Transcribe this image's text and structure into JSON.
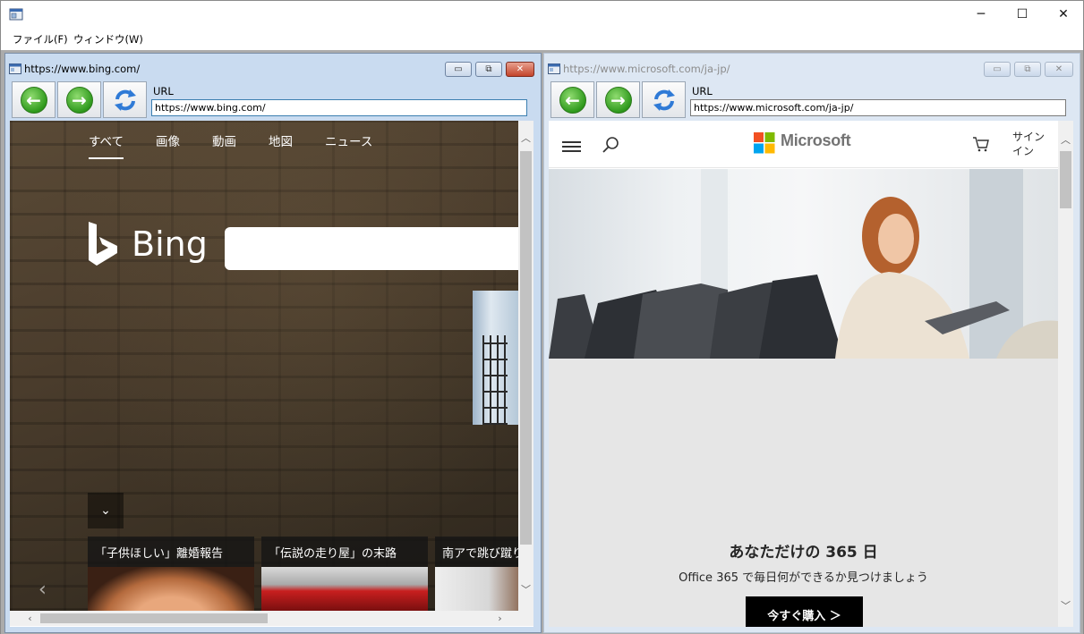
{
  "app": {
    "menu": [
      "ファイル(F)",
      "ウィンドウ(W)"
    ],
    "window_buttons": [
      "minimize",
      "maximize",
      "close"
    ]
  },
  "left_window": {
    "title": "https://www.bing.com/",
    "url_label": "URL",
    "url_value": "https://www.bing.com/",
    "page": {
      "tabs": [
        "すべて",
        "画像",
        "動画",
        "地図",
        "ニュース"
      ],
      "active_tab": "すべて",
      "logo_text": "Bing",
      "news": [
        "「子供ほしい」離婚報告",
        "「伝説の走り屋」の末路",
        "南アで跳び蹴り"
      ]
    }
  },
  "right_window": {
    "title": "https://www.microsoft.com/ja-jp/",
    "url_label": "URL",
    "url_value": "https://www.microsoft.com/ja-jp/",
    "page": {
      "logo_text": "Microsoft",
      "signin": "サインイン",
      "heading": "あなただけの 365 日",
      "subheading": "Office 365 で毎日何ができるか見つけましょう",
      "cta": "今すぐ購入 ＞"
    }
  },
  "colors": {
    "active_frame": "#c9dbf0",
    "nav_green": "#2f9a1d",
    "ms_red": "#f25022",
    "ms_green": "#7fba00",
    "ms_blue": "#00a4ef",
    "ms_yellow": "#ffb900"
  }
}
